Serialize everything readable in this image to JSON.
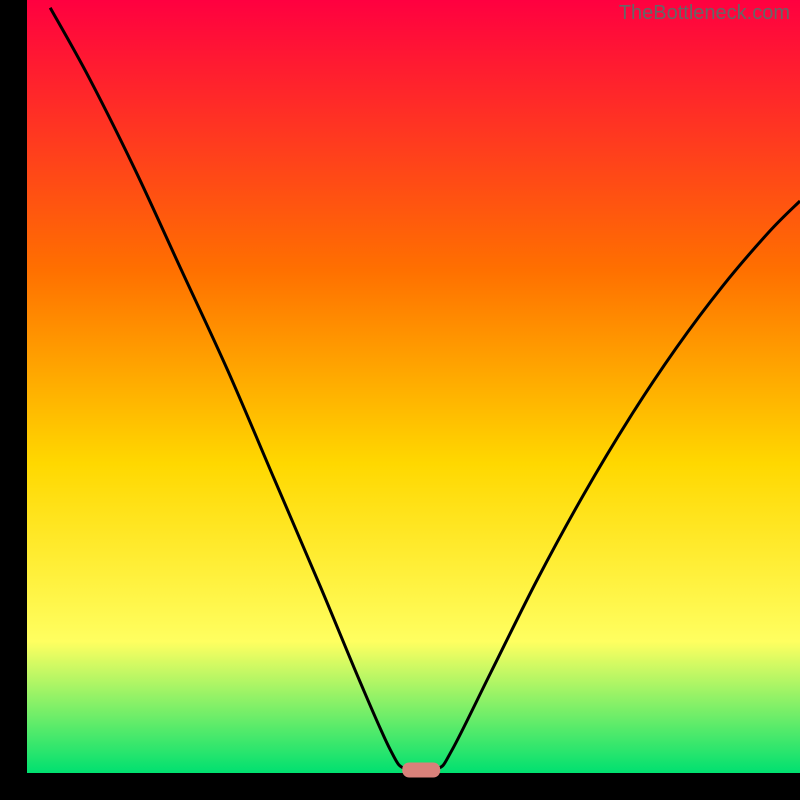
{
  "watermark": "TheBottleneck.com",
  "chart_data": {
    "type": "line",
    "title": "",
    "xlabel": "",
    "ylabel": "",
    "xlim": [
      0,
      100
    ],
    "ylim": [
      0,
      100
    ],
    "background_gradient": {
      "top": "#ff0040",
      "mid_upper": "#ff7000",
      "mid": "#ffd800",
      "mid_lower": "#ffff60",
      "bottom": "#00e070"
    },
    "curve": {
      "description": "V-shaped bottleneck curve with smooth sides and a flat narrow minimum",
      "points": [
        {
          "x": 3,
          "y": 99
        },
        {
          "x": 8,
          "y": 90
        },
        {
          "x": 14,
          "y": 78
        },
        {
          "x": 20,
          "y": 65
        },
        {
          "x": 26,
          "y": 52
        },
        {
          "x": 32,
          "y": 38
        },
        {
          "x": 38,
          "y": 24
        },
        {
          "x": 43,
          "y": 12
        },
        {
          "x": 47,
          "y": 3
        },
        {
          "x": 49,
          "y": 0.5
        },
        {
          "x": 53,
          "y": 0.5
        },
        {
          "x": 55,
          "y": 3
        },
        {
          "x": 60,
          "y": 13
        },
        {
          "x": 66,
          "y": 25
        },
        {
          "x": 72,
          "y": 36
        },
        {
          "x": 78,
          "y": 46
        },
        {
          "x": 84,
          "y": 55
        },
        {
          "x": 90,
          "y": 63
        },
        {
          "x": 96,
          "y": 70
        },
        {
          "x": 100,
          "y": 74
        }
      ]
    },
    "marker": {
      "x": 51,
      "y": 0,
      "shape": "pill",
      "color": "#d9817a"
    },
    "frame": {
      "left_border": 27,
      "bottom_border": 27,
      "color": "#000000"
    }
  }
}
